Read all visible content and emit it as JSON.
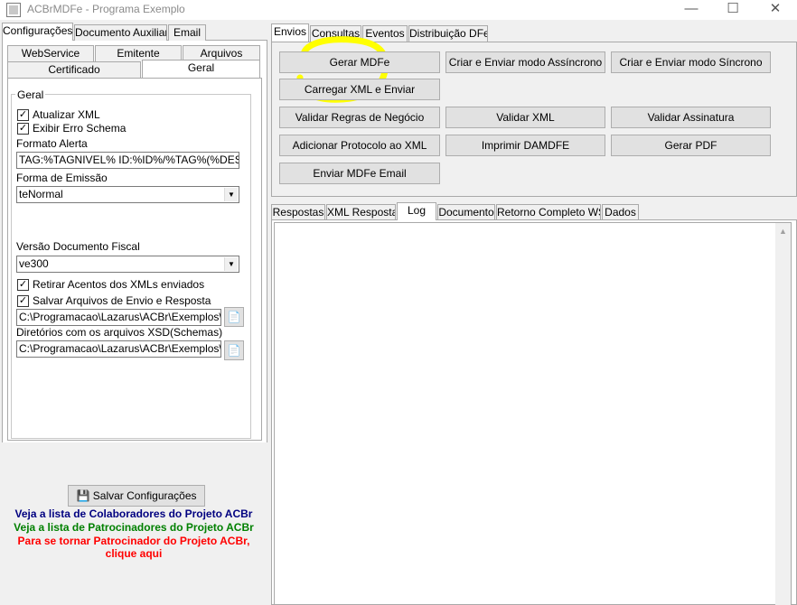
{
  "window": {
    "title": "ACBrMDFe - Programa Exemplo",
    "minimize_glyph": "—",
    "maximize_glyph": "☐",
    "close_glyph": "✕"
  },
  "left_tabs": [
    "Configurações",
    "Documento Auxiliar",
    "Email"
  ],
  "left_subtabs_row1": [
    "WebService",
    "Emitente",
    "Arquivos"
  ],
  "left_subtabs_row2": [
    "Certificado",
    "Geral"
  ],
  "geral": {
    "group_label": "Geral",
    "atualizar_xml": {
      "label": "Atualizar XML",
      "checked": true
    },
    "exibir_erro": {
      "label": "Exibir Erro Schema",
      "checked": true
    },
    "formato_alerta_label": "Formato Alerta",
    "formato_alerta_value": "TAG:%TAGNIVEL% ID:%ID%/%TAG%(%DESCRI",
    "forma_emissao_label": "Forma de Emissão",
    "forma_emissao_value": "teNormal",
    "versao_label": "Versão Documento Fiscal",
    "versao_value": "ve300",
    "retirar_acentos": {
      "label": "Retirar Acentos dos XMLs enviados",
      "checked": true
    },
    "salvar_arquivos": {
      "label": "Salvar Arquivos de Envio e Resposta",
      "checked": true
    },
    "salvar_path": "C:\\Programacao\\Lazarus\\ACBr\\Exemplos\\ACBr",
    "schemas_label": "Diretórios com os arquivos XSD(Schemas)",
    "schemas_path": "C:\\Programacao\\Lazarus\\ACBr\\Exemplos\\ACBr",
    "check_glyph": "✓",
    "dropdown_glyph": "▼",
    "browse_glyph": "📄"
  },
  "footer": {
    "save_button": "Salvar Configurações",
    "save_icon_glyph": "💾",
    "colaboradores_link": "Veja a lista de Colaboradores do Projeto ACBr",
    "patrocinadores_link": "Veja a lista de Patrocinadores do Projeto ACBr",
    "patrocinar_link_line1": "Para se tornar Patrocinador do Projeto ACBr,",
    "patrocinar_link_line2": "clique aqui"
  },
  "right_tabs": [
    "Envios",
    "Consultas",
    "Eventos",
    "Distribuição DFe"
  ],
  "envios_buttons": {
    "gerar_mdfe": "Gerar MDFe",
    "criar_enviar_assincrono": "Criar e Enviar modo Assíncrono",
    "criar_enviar_sincrono": "Criar e Enviar modo Síncrono",
    "carregar_xml": "Carregar XML e Enviar",
    "validar_regras": "Validar Regras de Negócio",
    "validar_xml": "Validar XML",
    "validar_assinatura": "Validar Assinatura",
    "adicionar_protocolo": "Adicionar Protocolo ao XML",
    "imprimir_damdfe": "Imprimir DAMDFE",
    "gerar_pdf": "Gerar PDF",
    "enviar_email": "Enviar MDFe Email"
  },
  "result_tabs": [
    "Respostas",
    "XML Resposta",
    "Log",
    "Documento",
    "Retorno Completo WS",
    "Dados"
  ],
  "scroll_up_glyph": "▲",
  "colors": {
    "highlight": "#ffff00",
    "link_navy": "#000080",
    "link_green": "#008000",
    "link_red": "#ff0000"
  }
}
